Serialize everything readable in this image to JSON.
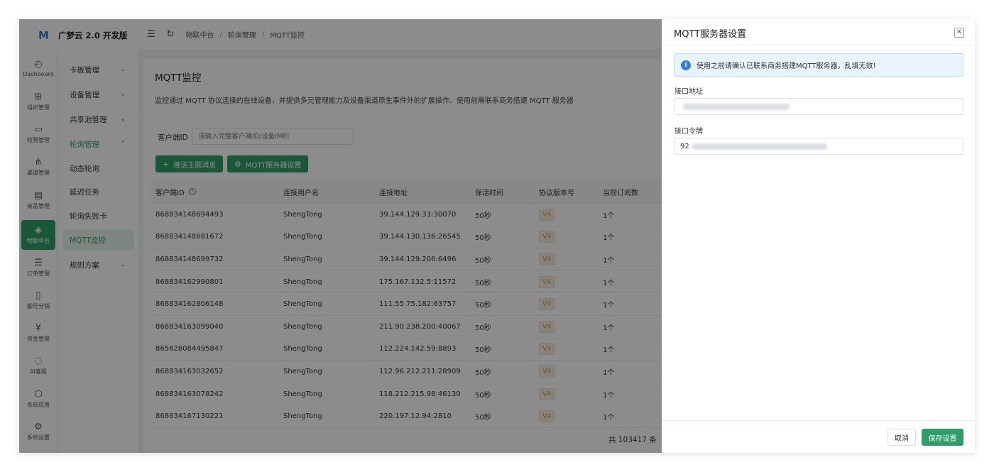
{
  "brand": {
    "name": "广梦云 2.0 开发版",
    "logo_icon": "m-logo-icon"
  },
  "rail": [
    {
      "label": "Dashboard",
      "icon": "gauge-icon",
      "glyph": "◴"
    },
    {
      "label": "组织管理",
      "icon": "grid-icon",
      "glyph": "⊞"
    },
    {
      "label": "权限管理",
      "icon": "monitor-icon",
      "glyph": "▭"
    },
    {
      "label": "渠道管理",
      "icon": "network-icon",
      "glyph": "⋔"
    },
    {
      "label": "商品管理",
      "icon": "shop-icon",
      "glyph": "▤"
    },
    {
      "label": "物联中台",
      "icon": "iot-icon",
      "glyph": "◈",
      "active": true
    },
    {
      "label": "订单管理",
      "icon": "list-icon",
      "glyph": "☰"
    },
    {
      "label": "靓号分销",
      "icon": "phone-icon",
      "glyph": "▯"
    },
    {
      "label": "资金管理",
      "icon": "yuan-icon",
      "glyph": "¥"
    },
    {
      "label": "AI客服",
      "icon": "chat-icon",
      "glyph": "◌"
    },
    {
      "label": "系统应用",
      "icon": "cube-icon",
      "glyph": "⬡"
    },
    {
      "label": "系统设置",
      "icon": "gear-icon",
      "glyph": "⚙"
    }
  ],
  "submenu": [
    {
      "label": "卡板管理",
      "chevron": "⌄"
    },
    {
      "label": "设备管理",
      "chevron": "⌄"
    },
    {
      "label": "共享池管理",
      "chevron": "⌄"
    },
    {
      "label": "轮询管理",
      "chevron": "⌃",
      "open": true
    },
    {
      "label": "动态轮询"
    },
    {
      "label": "延迟任务"
    },
    {
      "label": "轮询失败卡"
    },
    {
      "label": "MQTT监控",
      "active": true
    },
    {
      "label": "规则方案",
      "chevron": "⌄"
    }
  ],
  "header": {
    "breadcrumb": [
      "物联中台",
      "轮询管理",
      "MQTT监控"
    ],
    "separator": "/"
  },
  "page": {
    "title": "MQTT监控",
    "description": "监控通过 MQTT 协议连接的在线设备，并提供多元管理能力及设备渠道原生事件外的扩展操作。使用前需联系商务搭建 MQTT 服务器"
  },
  "search": {
    "label": "客户端ID",
    "placeholder": "请输入完整客户端ID/设备IMEI"
  },
  "toolbar": {
    "push_label": "推送主题消息",
    "mqtt_settings_label": "MQTT服务器设置"
  },
  "table": {
    "columns": [
      "客户端ID",
      "连接用户名",
      "连接地址",
      "保活时间",
      "协议版本号",
      "当前订阅数"
    ],
    "rows": [
      [
        "868834148694493",
        "ShengTong",
        "39.144.129.33:30070",
        "50秒",
        "V4",
        "1个"
      ],
      [
        "868834148681672",
        "ShengTong",
        "39.144.130.136:26545",
        "50秒",
        "V4",
        "1个"
      ],
      [
        "868834148699732",
        "ShengTong",
        "39.144.129.206:6496",
        "50秒",
        "V4",
        "1个"
      ],
      [
        "868834162990801",
        "ShengTong",
        "175.167.132.5:11572",
        "50秒",
        "V4",
        "1个"
      ],
      [
        "868834162806148",
        "ShengTong",
        "111.55.75.182:63757",
        "50秒",
        "V4",
        "1个"
      ],
      [
        "868834163099040",
        "ShengTong",
        "211.90.238.200:40067",
        "50秒",
        "V4",
        "1个"
      ],
      [
        "865628084495847",
        "ShengTong",
        "112.224.142.59:8893",
        "50秒",
        "V4",
        "1个"
      ],
      [
        "868834163032652",
        "ShengTong",
        "112.96.212.211:28909",
        "50秒",
        "V4",
        "1个"
      ],
      [
        "868834163078242",
        "ShengTong",
        "118.212.215.98:46130",
        "50秒",
        "V4",
        "1个"
      ],
      [
        "868834167130221",
        "ShengTong",
        "220.197.12.94:2810",
        "50秒",
        "V4",
        "1个"
      ]
    ],
    "total": "共 103417 条"
  },
  "drawer": {
    "title": "MQTT服务器设置",
    "alert": "使用之前请确认已联系商务搭建MQTT服务器，乱填无效!",
    "address_label": "接口地址",
    "token_label": "接口令牌",
    "token_prefix": "92",
    "cancel_label": "取消",
    "save_label": "保存设置"
  },
  "colors": {
    "accent": "#2e9e68",
    "tag_bg": "#f6efe0",
    "tag_text": "#d9a24b",
    "info": "#2f7fe0"
  }
}
